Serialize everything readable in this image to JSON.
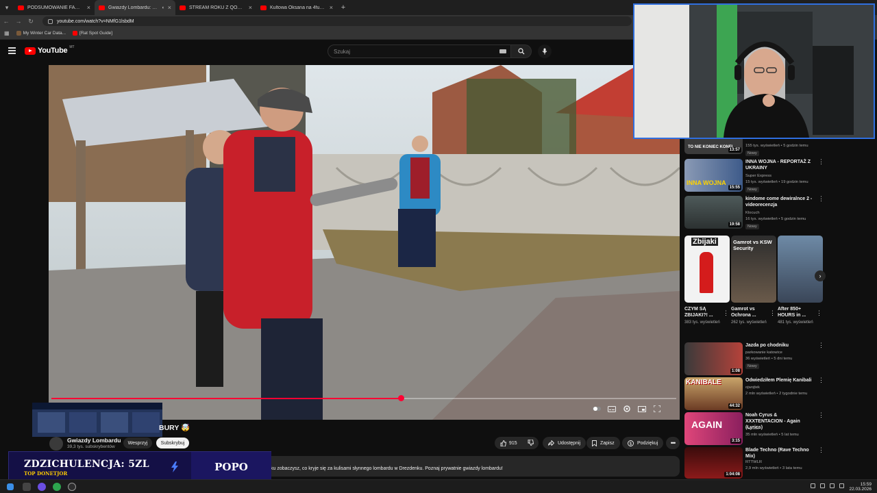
{
  "browser": {
    "tabs": [
      {
        "title": "PODSUMOWANIE FAME 30 (D…",
        "active": false
      },
      {
        "title": "Gwiazdy Lombardu: Grany…",
        "active": true
      },
      {
        "title": "STREAM ROKU Z QOQSIK | WS…",
        "active": false
      },
      {
        "title": "Kultowa Oksana na 4fun.tv - dy…",
        "active": false
      }
    ],
    "url": "youtube.com/watch?v=NMfG1lsbdM",
    "bookmarks": [
      "My Winter Car Data...",
      "[Rat Spot Guide]"
    ]
  },
  "youtube": {
    "logo": "YouTube",
    "logo_country": "MT",
    "search_placeholder": "Szukaj"
  },
  "video": {
    "title_visible": "BURY 🤯",
    "channel": "Gwiazdy Lombardu",
    "subscribers": "39,3 tys. subskrybentów",
    "support_label": "Wesprzyj",
    "subscribe_label": "Subskrybuj",
    "likes": "915",
    "share_label": "Udostępnij",
    "save_label": "Zapisz",
    "thanks_label": "Podziękuj",
    "progress": 0.56,
    "description": "ku zobaczysz, co kryje się za kulisami słynnego lombardu w Drezdenku. Poznaj prywatnie gwiazdy lombardu!"
  },
  "sidebar": {
    "top_item": {
      "thumb_text": "TO NIE KONIEC KONFL",
      "duration": "13:57",
      "meta": "155 tys. wyświetleń • 5 godzin temu",
      "badge": "Nowy"
    },
    "items": [
      {
        "title": "INNA WOJNA - REPORTAŻ Z UKRAINY",
        "channel": "Super Express",
        "meta": "15 tys. wyświetleń • 19 godzin temu",
        "badge": "Nowy",
        "duration": "15:55",
        "thumb_text": "INNA WOJNA"
      },
      {
        "title": "kindome come dewiralnce 2 - videorecenzja",
        "channel": "Klocuch",
        "meta": "16 tys. wyświetleń • 5 godzin temu",
        "badge": "Nowy",
        "duration": "19:58"
      }
    ],
    "shorts": [
      {
        "title": "CZYM SĄ ZBIJAKI?! ...",
        "views": "383 tys. wyświetleń",
        "thumb_text": "Zbijaki"
      },
      {
        "title": "Gamrot vs Ochrona ...",
        "views": "262 tys. wyświetleń",
        "thumb_text": "Gamrot vs KSW Security"
      },
      {
        "title": "After 850+ HOURS in ...",
        "views": "481 tys. wyświetleń"
      }
    ],
    "items2": [
      {
        "title": "Jazda po chodniku",
        "channel": "parkowanie katowice",
        "meta": "36 wyświetleń • 5 dni temu",
        "badge": "Nowy",
        "duration": "1:08"
      },
      {
        "title": "Odwiedziłem Plemię Kanibali",
        "channel": "ojwojtek",
        "meta": "2 mln wyświetleń • 2 tygodnie temu",
        "duration": "44:32",
        "thumb_text": "KANIBALE"
      },
      {
        "title": "Noah Cyrus & XXXTENTACION - Again (Lyrics)",
        "channel": "7clouds",
        "meta": "35 mln wyświetleń • 5 lat temu",
        "duration": "3:15",
        "thumb_text": "AGAIN"
      },
      {
        "title": "Blade Techno (Rave Techno Mix)",
        "channel": "RTTWLR",
        "meta": "2,9 mln wyświetleń • 3 lata temu",
        "duration": "1:04:08"
      }
    ]
  },
  "donation": {
    "text": "ZDZICHULENCJA: 5ZL",
    "sub": "TOP DONETJOR",
    "right": "POPO"
  },
  "taskbar": {
    "time": "15:59",
    "date": "22.03.2026"
  }
}
